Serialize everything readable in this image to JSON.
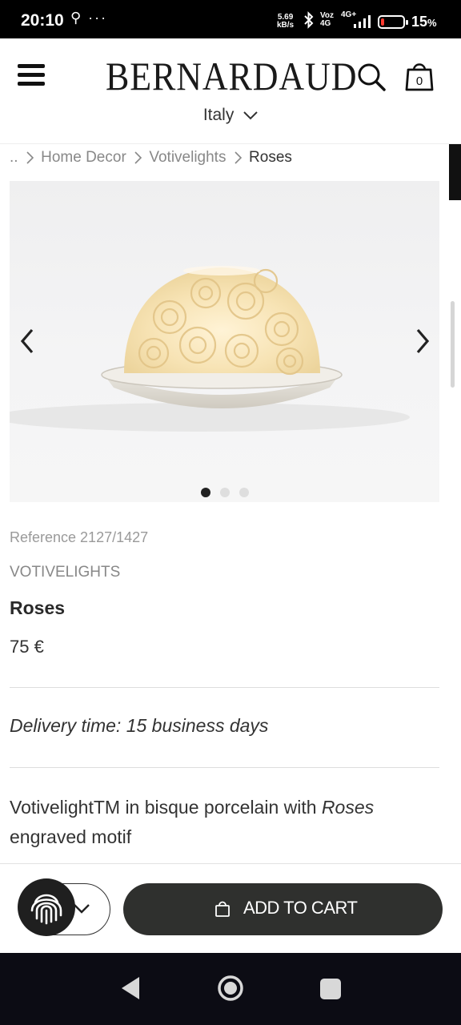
{
  "status_bar": {
    "time": "20:10",
    "notification_icons": "⚲ ···",
    "speed_value": "5.69",
    "speed_unit": "kB/s",
    "network_top": "Voz",
    "network_bottom": "4G",
    "network_type": "4G+",
    "battery_percent": "15",
    "battery_unit": "%",
    "battery_level": 0.15
  },
  "header": {
    "brand": "BERNARDAUD",
    "country": "Italy"
  },
  "breadcrumb": {
    "items": [
      "..",
      "Home Decor",
      "Votivelights"
    ],
    "current": "Roses"
  },
  "carousel": {
    "slide_count": 3,
    "active_index": 0
  },
  "product": {
    "reference": "Reference 2127/1427",
    "collection": "VOTIVELIGHTS",
    "name": "Roses",
    "price": "75 €",
    "delivery": "Delivery time: 15 business days",
    "description_before": "VotivelightTM in bisque porcelain with ",
    "description_emphasis": "Roses",
    "description_after": " engraved motif"
  },
  "actions": {
    "add_to_cart_label": "ADD TO CART",
    "cart_count": "0"
  },
  "colors": {
    "button_dark": "#2f302e",
    "battery_low": "#ff3b30"
  }
}
